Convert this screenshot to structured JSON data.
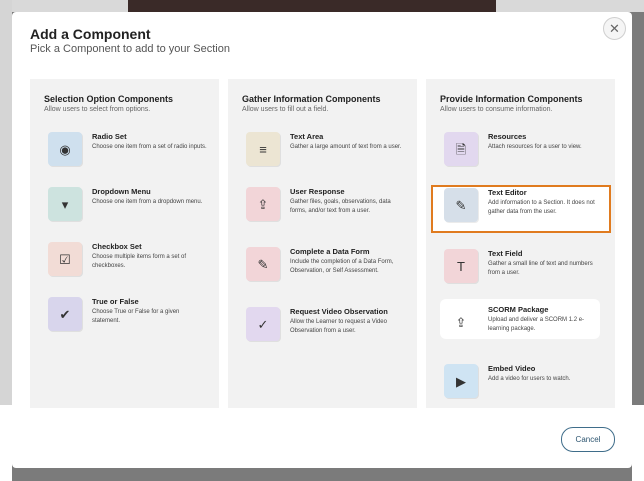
{
  "modal": {
    "title": "Add a Component",
    "subtitle": "Pick a Component to add to your Section",
    "close_icon": "✕",
    "cancel_label": "Cancel"
  },
  "columns": [
    {
      "title": "Selection Option Components",
      "description": "Allow users to select from options.",
      "items": [
        {
          "name": "Radio Set",
          "desc": "Choose one item from a set of radio inputs.",
          "icon": "radio-icon",
          "glyph": "◉"
        },
        {
          "name": "Dropdown Menu",
          "desc": "Choose one item from a dropdown menu.",
          "icon": "dropdown-icon",
          "glyph": "▾"
        },
        {
          "name": "Checkbox Set",
          "desc": "Choose multiple items form a set of checkboxes.",
          "icon": "checkbox-icon",
          "glyph": "☑"
        },
        {
          "name": "True or False",
          "desc": "Choose True or False for a given statement.",
          "icon": "chat-check-icon",
          "glyph": "✔"
        }
      ]
    },
    {
      "title": "Gather Information Components",
      "description": "Allow users to fill out a field.",
      "items": [
        {
          "name": "Text Area",
          "desc": "Gather a large amount of text from a user.",
          "icon": "text-lines-icon",
          "glyph": "≡"
        },
        {
          "name": "User Response",
          "desc": "Gather files, goals, observations, data forms, and/or text from a user.",
          "icon": "file-upload-icon",
          "glyph": "⇪"
        },
        {
          "name": "Complete a Data Form",
          "desc": "Include the completion of a Data Form, Observation, or Self Assessment.",
          "icon": "edit-icon",
          "glyph": "✎"
        },
        {
          "name": "Request Video Observation",
          "desc": "Allow the Learner to request a Video Observation from a user.",
          "icon": "check-circle-icon",
          "glyph": "✓"
        }
      ]
    },
    {
      "title": "Provide Information Components",
      "description": "Allow users to consume information.",
      "items": [
        {
          "name": "Resources",
          "desc": "Attach resources for a user to view.",
          "icon": "file-icon",
          "glyph": "🗎"
        },
        {
          "name": "Text Editor",
          "desc": "Add information to a Section. It does not gather data from the user.",
          "icon": "pencil-icon",
          "glyph": "✎"
        },
        {
          "name": "Text Field",
          "desc": "Gather a small line of text and numbers from a user.",
          "icon": "text-t-icon",
          "glyph": "T"
        },
        {
          "name": "SCORM Package",
          "desc": "Upload and deliver a SCORM 1.2 e-learning package.",
          "icon": "file-upload-icon",
          "glyph": "⇪"
        },
        {
          "name": "Embed Video",
          "desc": "Add a video for users to watch.",
          "icon": "play-icon",
          "glyph": "▶"
        }
      ]
    }
  ]
}
